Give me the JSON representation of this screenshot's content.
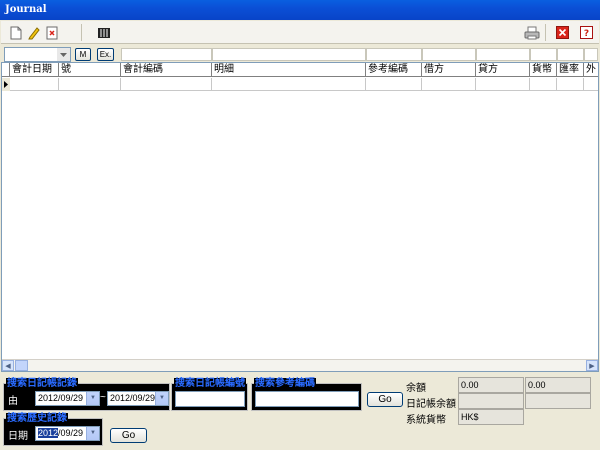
{
  "window": {
    "title": "Journal"
  },
  "toolbar": {
    "items": [
      "new-icon",
      "edit-icon",
      "delete-icon",
      "columns-icon",
      "print-icon",
      "close-icon",
      "help-icon"
    ],
    "close_color": "#d9241b"
  },
  "filter": {
    "m_label": "M",
    "ex_label": "Ex."
  },
  "grid": {
    "columns": [
      "會計日期",
      "號",
      "會計編碼",
      "明細",
      "參考編碼",
      "借方",
      "貸方",
      "貨幣",
      "匯率",
      "外"
    ]
  },
  "search_journal": {
    "legend": "搜索日記帳記錄",
    "from_label": "由",
    "from_date": "2012/09/29",
    "separator": "~",
    "to_date": "2012/09/29"
  },
  "search_journal_number": {
    "legend": "搜索日記帳編號",
    "value": ""
  },
  "search_reference": {
    "legend": "搜索參考編碼",
    "value": ""
  },
  "go_label": "Go",
  "search_history": {
    "legend": "搜索歷史記錄",
    "date_label": "日期",
    "date_year": "2012",
    "date_rest": "/09/29",
    "go_label": "Go"
  },
  "summary": {
    "balance_label": "余額",
    "balance_value_1": "0.00",
    "balance_value_2": "0.00",
    "journal_balance_label": "日記帳余額",
    "journal_balance_value_1": "",
    "journal_balance_value_2": "",
    "system_currency_label": "系統貨幣",
    "system_currency_value": "HK$"
  },
  "colors": {
    "legend_text": "#2a6bff",
    "title_bar": "#0b4fd6"
  }
}
